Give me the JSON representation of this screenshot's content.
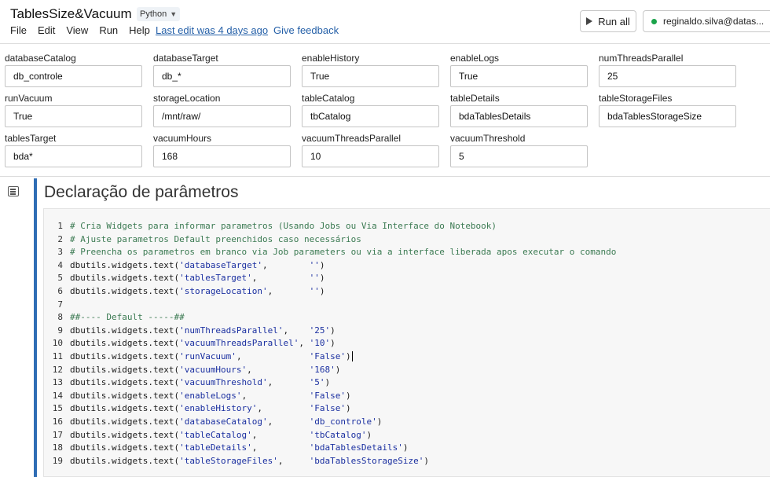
{
  "header": {
    "title": "TablesSize&Vacuum",
    "language": "Python",
    "menu": [
      "File",
      "Edit",
      "View",
      "Run",
      "Help"
    ],
    "last_edit": "Last edit was 4 days ago",
    "feedback": "Give feedback",
    "run_all": "Run all",
    "cluster": "reginaldo.silva@datas..."
  },
  "widgets": {
    "row1": [
      {
        "label": "databaseCatalog",
        "value": "db_controle"
      },
      {
        "label": "databaseTarget",
        "value": "db_*"
      },
      {
        "label": "enableHistory",
        "value": "True"
      },
      {
        "label": "enableLogs",
        "value": "True"
      },
      {
        "label": "numThreadsParallel",
        "value": "25"
      }
    ],
    "row2": [
      {
        "label": "runVacuum",
        "value": "True"
      },
      {
        "label": "storageLocation",
        "value": "/mnt/raw/"
      },
      {
        "label": "tableCatalog",
        "value": "tbCatalog"
      },
      {
        "label": "tableDetails",
        "value": "bdaTablesDetails"
      },
      {
        "label": "tableStorageFiles",
        "value": "bdaTablesStorageSize"
      }
    ],
    "row3": [
      {
        "label": "tablesTarget",
        "value": "bda*"
      },
      {
        "label": "vacuumHours",
        "value": "168"
      },
      {
        "label": "vacuumThreadsParallel",
        "value": "10"
      },
      {
        "label": "vacuumThreshold",
        "value": "5"
      }
    ]
  },
  "cell": {
    "title": "Declaração de parâmetros",
    "lines": [
      {
        "n": "1",
        "parts": [
          [
            "cm",
            "# Cria Widgets para informar parametros (Usando Jobs ou Via Interface do Notebook)"
          ]
        ]
      },
      {
        "n": "2",
        "parts": [
          [
            "cm",
            "# Ajuste parametros Default preenchidos caso necessários"
          ]
        ]
      },
      {
        "n": "3",
        "parts": [
          [
            "cm",
            "# Preencha os parametros em branco via Job parameters ou via a interface liberada apos executar o comando"
          ]
        ]
      },
      {
        "n": "4",
        "parts": [
          [
            "",
            "dbutils.widgets.text("
          ],
          [
            "st",
            "'databaseTarget'"
          ],
          [
            "",
            ",        "
          ],
          [
            "st",
            "''"
          ],
          [
            "",
            ")"
          ]
        ]
      },
      {
        "n": "5",
        "parts": [
          [
            "",
            "dbutils.widgets.text("
          ],
          [
            "st",
            "'tablesTarget'"
          ],
          [
            "",
            ",          "
          ],
          [
            "st",
            "''"
          ],
          [
            "",
            ")"
          ]
        ]
      },
      {
        "n": "6",
        "parts": [
          [
            "",
            "dbutils.widgets.text("
          ],
          [
            "st",
            "'storageLocation'"
          ],
          [
            "",
            ",       "
          ],
          [
            "st",
            "''"
          ],
          [
            "",
            ")"
          ]
        ]
      },
      {
        "n": "7",
        "parts": [
          [
            "",
            ""
          ]
        ]
      },
      {
        "n": "8",
        "parts": [
          [
            "cm",
            "##---- Default -----##"
          ]
        ]
      },
      {
        "n": "9",
        "parts": [
          [
            "",
            "dbutils.widgets.text("
          ],
          [
            "st",
            "'numThreadsParallel'"
          ],
          [
            "",
            ",    "
          ],
          [
            "st",
            "'25'"
          ],
          [
            "",
            ")"
          ]
        ]
      },
      {
        "n": "10",
        "parts": [
          [
            "",
            "dbutils.widgets.text("
          ],
          [
            "st",
            "'vacuumThreadsParallel'"
          ],
          [
            "",
            ", "
          ],
          [
            "st",
            "'10'"
          ],
          [
            "",
            ")"
          ]
        ]
      },
      {
        "n": "11",
        "parts": [
          [
            "",
            "dbutils.widgets.text("
          ],
          [
            "st",
            "'runVacuum'"
          ],
          [
            "",
            ",             "
          ],
          [
            "st",
            "'False'"
          ],
          [
            "",
            ")"
          ],
          [
            "caret",
            ""
          ]
        ]
      },
      {
        "n": "12",
        "parts": [
          [
            "",
            "dbutils.widgets.text("
          ],
          [
            "st",
            "'vacuumHours'"
          ],
          [
            "",
            ",           "
          ],
          [
            "st",
            "'168'"
          ],
          [
            "",
            ")"
          ]
        ]
      },
      {
        "n": "13",
        "parts": [
          [
            "",
            "dbutils.widgets.text("
          ],
          [
            "st",
            "'vacuumThreshold'"
          ],
          [
            "",
            ",       "
          ],
          [
            "st",
            "'5'"
          ],
          [
            "",
            ")"
          ]
        ]
      },
      {
        "n": "14",
        "parts": [
          [
            "",
            "dbutils.widgets.text("
          ],
          [
            "st",
            "'enableLogs'"
          ],
          [
            "",
            ",            "
          ],
          [
            "st",
            "'False'"
          ],
          [
            "",
            ")"
          ]
        ]
      },
      {
        "n": "15",
        "parts": [
          [
            "",
            "dbutils.widgets.text("
          ],
          [
            "st",
            "'enableHistory'"
          ],
          [
            "",
            ",         "
          ],
          [
            "st",
            "'False'"
          ],
          [
            "",
            ")"
          ]
        ]
      },
      {
        "n": "16",
        "parts": [
          [
            "",
            "dbutils.widgets.text("
          ],
          [
            "st",
            "'databaseCatalog'"
          ],
          [
            "",
            ",       "
          ],
          [
            "st",
            "'db_controle'"
          ],
          [
            "",
            ")"
          ]
        ]
      },
      {
        "n": "17",
        "parts": [
          [
            "",
            "dbutils.widgets.text("
          ],
          [
            "st",
            "'tableCatalog'"
          ],
          [
            "",
            ",          "
          ],
          [
            "st",
            "'tbCatalog'"
          ],
          [
            "",
            ")"
          ]
        ]
      },
      {
        "n": "18",
        "parts": [
          [
            "",
            "dbutils.widgets.text("
          ],
          [
            "st",
            "'tableDetails'"
          ],
          [
            "",
            ",          "
          ],
          [
            "st",
            "'bdaTablesDetails'"
          ],
          [
            "",
            ")"
          ]
        ]
      },
      {
        "n": "19",
        "parts": [
          [
            "",
            "dbutils.widgets.text("
          ],
          [
            "st",
            "'tableStorageFiles'"
          ],
          [
            "",
            ",     "
          ],
          [
            "st",
            "'bdaTablesStorageSize'"
          ],
          [
            "",
            ")"
          ]
        ]
      }
    ]
  }
}
